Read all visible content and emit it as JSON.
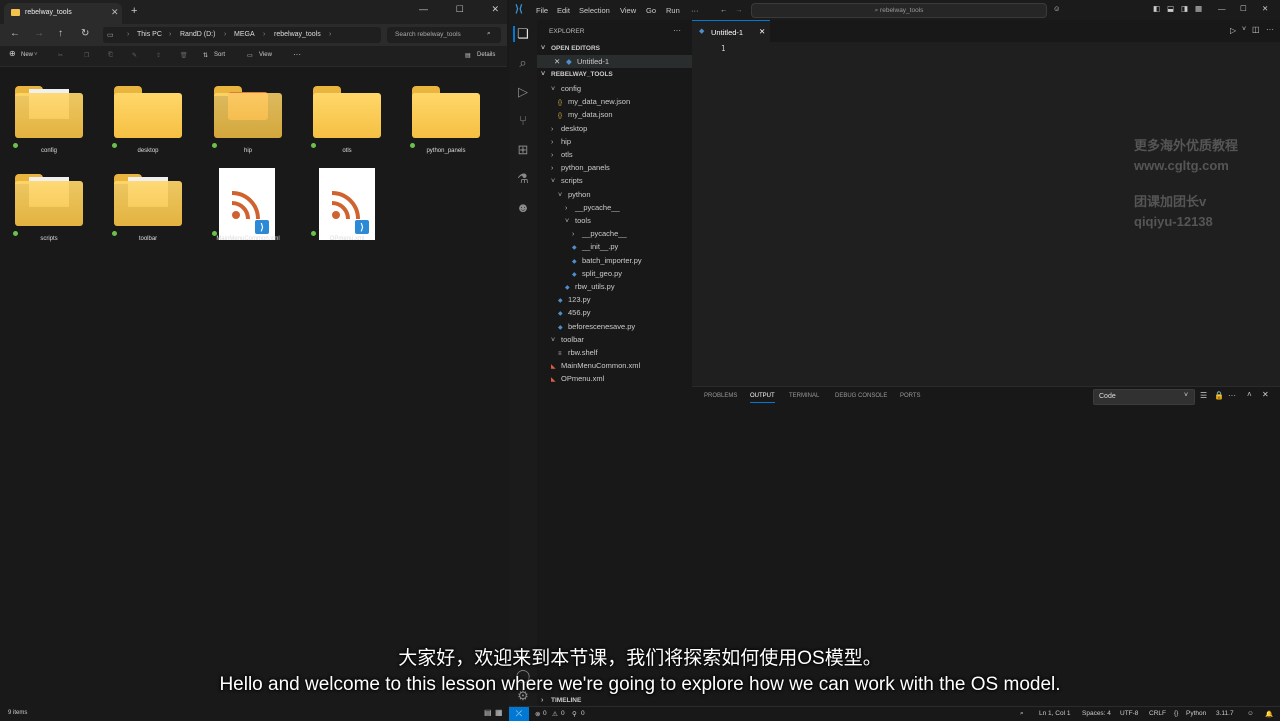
{
  "explorer": {
    "tab_title": "rebelway_tools",
    "tab_close": "✕",
    "new_tab": "+",
    "window_controls": [
      "—",
      "☐",
      "✕"
    ],
    "nav": {
      "back": "←",
      "forward": "→",
      "up": "↑",
      "refresh": "↻"
    },
    "breadcrumb": [
      "This PC",
      "RandD (D:)",
      "MEGA",
      "rebelway_tools"
    ],
    "search_placeholder": "Search rebelway_tools",
    "toolbar": {
      "new": "New",
      "sort": "Sort",
      "view": "View",
      "more": "···",
      "details": "Details"
    },
    "items": [
      {
        "name": "config",
        "kind": "folder-doc"
      },
      {
        "name": "desktop",
        "kind": "folder"
      },
      {
        "name": "hip",
        "kind": "folder-rss"
      },
      {
        "name": "otls",
        "kind": "folder"
      },
      {
        "name": "python_panels",
        "kind": "folder"
      },
      {
        "name": "scripts",
        "kind": "folder-py"
      },
      {
        "name": "toolbar",
        "kind": "folder-doc"
      },
      {
        "name": "MainMenuCommon.xml",
        "kind": "xml"
      },
      {
        "name": "OPmenu.xml",
        "kind": "xml"
      }
    ],
    "status": "9 items"
  },
  "vscode": {
    "menu": [
      "File",
      "Edit",
      "Selection",
      "View",
      "Go",
      "Run",
      "···"
    ],
    "command_center": "rebelway_tools",
    "sidebar": {
      "title": "EXPLORER",
      "more": "···",
      "open_editors_label": "OPEN EDITORS",
      "open_editor": "Untitled-1",
      "root": "REBELWAY_TOOLS",
      "tree": [
        {
          "label": "config",
          "type": "folder-open",
          "depth": 0
        },
        {
          "label": "my_data_new.json",
          "type": "json",
          "depth": 1
        },
        {
          "label": "my_data.json",
          "type": "json",
          "depth": 1
        },
        {
          "label": "desktop",
          "type": "folder",
          "depth": 0
        },
        {
          "label": "hip",
          "type": "folder",
          "depth": 0
        },
        {
          "label": "otls",
          "type": "folder",
          "depth": 0
        },
        {
          "label": "python_panels",
          "type": "folder",
          "depth": 0
        },
        {
          "label": "scripts",
          "type": "folder-open",
          "depth": 0
        },
        {
          "label": "python",
          "type": "folder-open",
          "depth": 1
        },
        {
          "label": "__pycache__",
          "type": "folder",
          "depth": 2
        },
        {
          "label": "tools",
          "type": "folder-open",
          "depth": 2
        },
        {
          "label": "__pycache__",
          "type": "folder",
          "depth": 3
        },
        {
          "label": "__init__.py",
          "type": "py",
          "depth": 3
        },
        {
          "label": "batch_importer.py",
          "type": "py",
          "depth": 3
        },
        {
          "label": "split_geo.py",
          "type": "py",
          "depth": 3
        },
        {
          "label": "rbw_utils.py",
          "type": "py",
          "depth": 2
        },
        {
          "label": "123.py",
          "type": "py",
          "depth": 1
        },
        {
          "label": "456.py",
          "type": "py",
          "depth": 1
        },
        {
          "label": "beforescenesave.py",
          "type": "py",
          "depth": 1
        },
        {
          "label": "toolbar",
          "type": "folder-open",
          "depth": 0
        },
        {
          "label": "rbw.shelf",
          "type": "shelf",
          "depth": 1
        },
        {
          "label": "MainMenuCommon.xml",
          "type": "xml",
          "depth": 0
        },
        {
          "label": "OPmenu.xml",
          "type": "xml",
          "depth": 0
        }
      ],
      "timeline": "TIMELINE"
    },
    "editor": {
      "tab": "Untitled-1",
      "line_number": "1"
    },
    "panel": {
      "tabs": [
        "PROBLEMS",
        "OUTPUT",
        "TERMINAL",
        "DEBUG CONSOLE",
        "PORTS"
      ],
      "active_tab": "OUTPUT",
      "output_channel": "Code"
    },
    "status": {
      "errors": "0",
      "warnings": "0",
      "ports": "0",
      "position": "Ln 1, Col 1",
      "spaces": "Spaces: 4",
      "encoding": "UTF-8",
      "eol": "CRLF",
      "language": "Python",
      "version": "3.11.7"
    }
  },
  "watermark": [
    "更多海外优质教程",
    "www.cgltg.com",
    "团课加团长v",
    "qiqiyu-12138"
  ],
  "subtitles": {
    "zh": "大家好，欢迎来到本节课，我们将探索如何使用OS模型。",
    "en": "Hello and welcome to this lesson where we're going to explore how we can work with the OS model."
  },
  "colors": {
    "accent": "#0078d4",
    "folder": "#f5c043",
    "py": "#4d8fcc",
    "json": "#d4b84a",
    "xml": "#e05a45"
  }
}
